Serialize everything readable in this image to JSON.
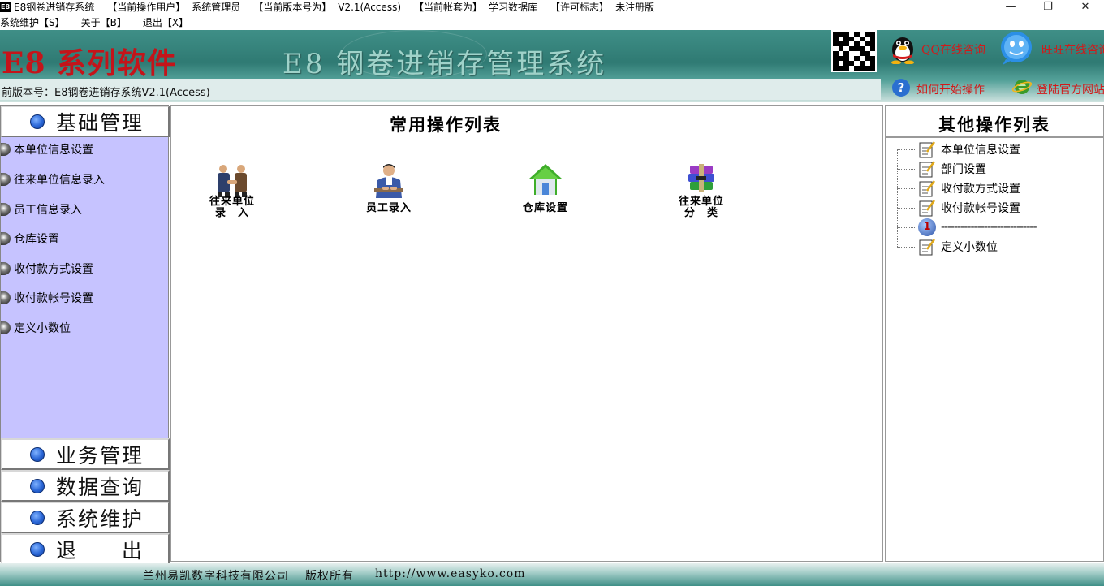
{
  "window": {
    "app_icon_text": "E8",
    "title": "E8钢卷进销存系统",
    "fields": [
      {
        "key": "【当前操作用户】",
        "value": "系统管理员"
      },
      {
        "key": "【当前版本号为】",
        "value": "V2.1(Access)"
      },
      {
        "key": "【当前帐套为】",
        "value": "学习数据库"
      },
      {
        "key": "【许可标志】",
        "value": "未注册版"
      }
    ],
    "controls": {
      "minimize": "—",
      "restore": "❐",
      "close": "✕"
    }
  },
  "menu": {
    "items": [
      "系统维护【S】",
      "关于【B】",
      "退出【X】"
    ]
  },
  "banner": {
    "brand": "E8 系列软件",
    "system_title": "E8 钢卷进销存管理系统",
    "version_line": "前版本号：E8钢卷进销存系统V2.1(Access)",
    "links": {
      "qq_consult": "QQ在线咨询",
      "online_consult": "旺旺在线咨询",
      "how_to_start": "如何开始操作",
      "official_site": "登陆官方网站"
    }
  },
  "left_panel": {
    "active_category": "基础管理",
    "items": [
      "本单位信息设置",
      "往来单位信息录入",
      "员工信息录入",
      "仓库设置",
      "收付款方式设置",
      "收付款帐号设置",
      "定义小数位"
    ],
    "other_categories": [
      "业务管理",
      "数据查询",
      "系统维护",
      "退　　出"
    ]
  },
  "center_panel": {
    "title": "常用操作列表",
    "operations": [
      {
        "line1": "往来单位",
        "line2": "录　入",
        "icon": "handshake-icon"
      },
      {
        "line1": "员工录入",
        "line2": "",
        "icon": "employee-icon"
      },
      {
        "line1": "仓库设置",
        "line2": "",
        "icon": "house-icon"
      },
      {
        "line1": "往来单位",
        "line2": "分　类",
        "icon": "books-stack-icon"
      }
    ]
  },
  "right_panel": {
    "title": "其他操作列表",
    "items": [
      "本单位信息设置",
      "部门设置",
      "收付款方式设置",
      "收付款帐号设置",
      "-----------------------------",
      "定义小数位"
    ]
  },
  "footer": {
    "company": "兰州易凯数字科技有限公司",
    "rights": "版权所有",
    "url": "http://www.easyko.com"
  }
}
